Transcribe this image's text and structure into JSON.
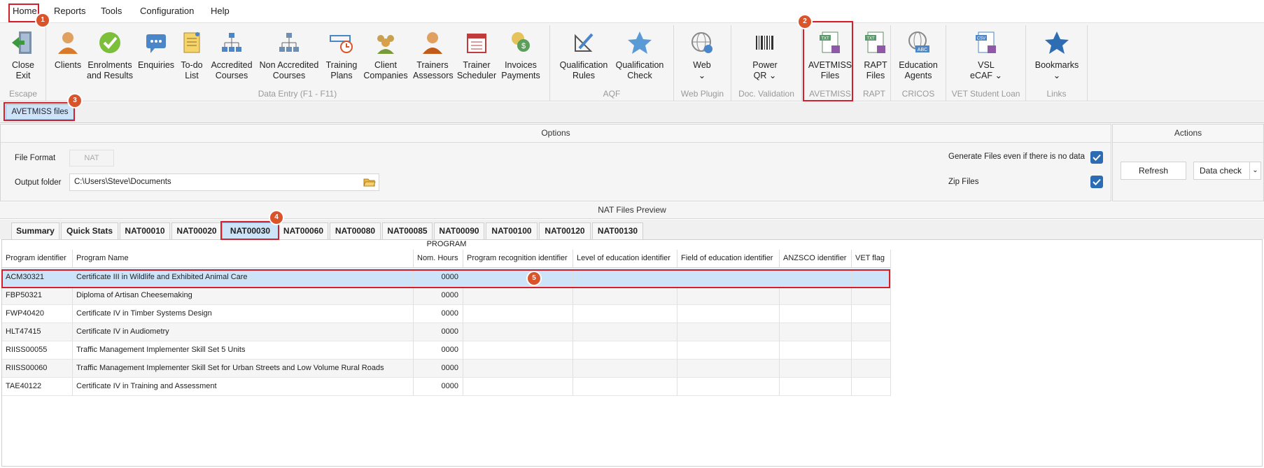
{
  "menu": [
    "Home",
    "Reports",
    "Tools",
    "Configuration",
    "Help"
  ],
  "ribbon": {
    "buttons": [
      {
        "label": "Close\nExit",
        "icon": "close-exit-icon"
      },
      {
        "label": "Clients",
        "icon": "client-person-icon"
      },
      {
        "label": "Enrolments\nand Results",
        "icon": "checkmark-circle-icon"
      },
      {
        "label": "Enquiries",
        "icon": "chat-bubble-icon"
      },
      {
        "label": "To-do\nList",
        "icon": "notepad-icon"
      },
      {
        "label": "Accredited\nCourses",
        "icon": "org-chart-icon"
      },
      {
        "label": "Non Accredited\nCourses",
        "icon": "hierarchy-icon"
      },
      {
        "label": "Training\nPlans",
        "icon": "ruler-clock-icon"
      },
      {
        "label": "Client\nCompanies",
        "icon": "group-icon"
      },
      {
        "label": "Trainers\nAssessors",
        "icon": "trainer-icon"
      },
      {
        "label": "Trainer\nScheduler",
        "icon": "calendar-icon"
      },
      {
        "label": "Invoices\nPayments",
        "icon": "coins-icon"
      },
      {
        "label": "Qualification\nRules",
        "icon": "pencil-square-icon"
      },
      {
        "label": "Qualification\nCheck",
        "icon": "star-icon"
      },
      {
        "label": "Web\n⌄",
        "icon": "globe-icon"
      },
      {
        "label": "Power\nQR ⌄",
        "icon": "barcode-icon"
      },
      {
        "label": "AVETMISS\nFiles",
        "icon": "txt-file-icon"
      },
      {
        "label": "RAPT\nFiles",
        "icon": "txt-file-icon"
      },
      {
        "label": "Education\nAgents",
        "icon": "abc-globe-icon"
      },
      {
        "label": "VSL\neCAF ⌄",
        "icon": "csv-file-icon"
      },
      {
        "label": "Bookmarks\n⌄",
        "icon": "bookmark-star-icon"
      }
    ],
    "groups": [
      "Escape",
      "Data Entry (F1 - F11)",
      "AQF",
      "Web Plugin",
      "Doc. Validation",
      "AVETMISS",
      "RAPT",
      "CRICOS",
      "VET Student Loan",
      "Links"
    ]
  },
  "doc_tab": "AVETMISS files",
  "options": {
    "title": "Options",
    "file_format_label": "File Format",
    "file_format_value": "NAT",
    "output_folder_label": "Output folder",
    "output_folder_value": "C:\\Users\\Steve\\Documents",
    "generate_label": "Generate Files even if there is no data",
    "generate_checked": true,
    "zip_label": "Zip Files",
    "zip_checked": true
  },
  "actions": {
    "title": "Actions",
    "refresh": "Refresh",
    "data_check": "Data check"
  },
  "preview": {
    "title": "NAT Files Preview",
    "tabs": [
      "Summary",
      "Quick Stats",
      "NAT00010",
      "NAT00020",
      "NAT00030",
      "NAT00060",
      "NAT00080",
      "NAT00085",
      "NAT00090",
      "NAT00100",
      "NAT00120",
      "NAT00130"
    ],
    "active_tab": "NAT00030",
    "grid_title": "PROGRAM",
    "columns": [
      "Program identifier",
      "Program Name",
      "Nom. Hours",
      "Program recognition identifier",
      "Level of education identifier",
      "Field of education identifier",
      "ANZSCO identifier",
      "VET flag"
    ],
    "rows": [
      [
        "ACM30321",
        "Certificate III in Wildlife and Exhibited Animal Care",
        "0000",
        "",
        "",
        "",
        "",
        ""
      ],
      [
        "FBP50321",
        "Diploma of Artisan Cheesemaking",
        "0000",
        "",
        "",
        "",
        "",
        ""
      ],
      [
        "FWP40420",
        "Certificate IV in Timber Systems Design",
        "0000",
        "",
        "",
        "",
        "",
        ""
      ],
      [
        "HLT47415",
        "Certificate IV in Audiometry",
        "0000",
        "",
        "",
        "",
        "",
        ""
      ],
      [
        "RIISS00055",
        "Traffic Management Implementer Skill Set 5 Units",
        "0000",
        "",
        "",
        "",
        "",
        ""
      ],
      [
        "RIISS00060",
        "Traffic Management Implementer Skill Set for Urban Streets and Low Volume Rural Roads",
        "0000",
        "",
        "",
        "",
        "",
        ""
      ],
      [
        "TAE40122",
        "Certificate IV in Training and Assessment",
        "0000",
        "",
        "",
        "",
        "",
        ""
      ]
    ]
  },
  "markers": [
    "1",
    "2",
    "3",
    "4",
    "5"
  ],
  "colors": {
    "accent": "#2b6cb5",
    "selection": "#cde3f7",
    "annotation": "#d4202a",
    "marker": "#d9532b"
  }
}
